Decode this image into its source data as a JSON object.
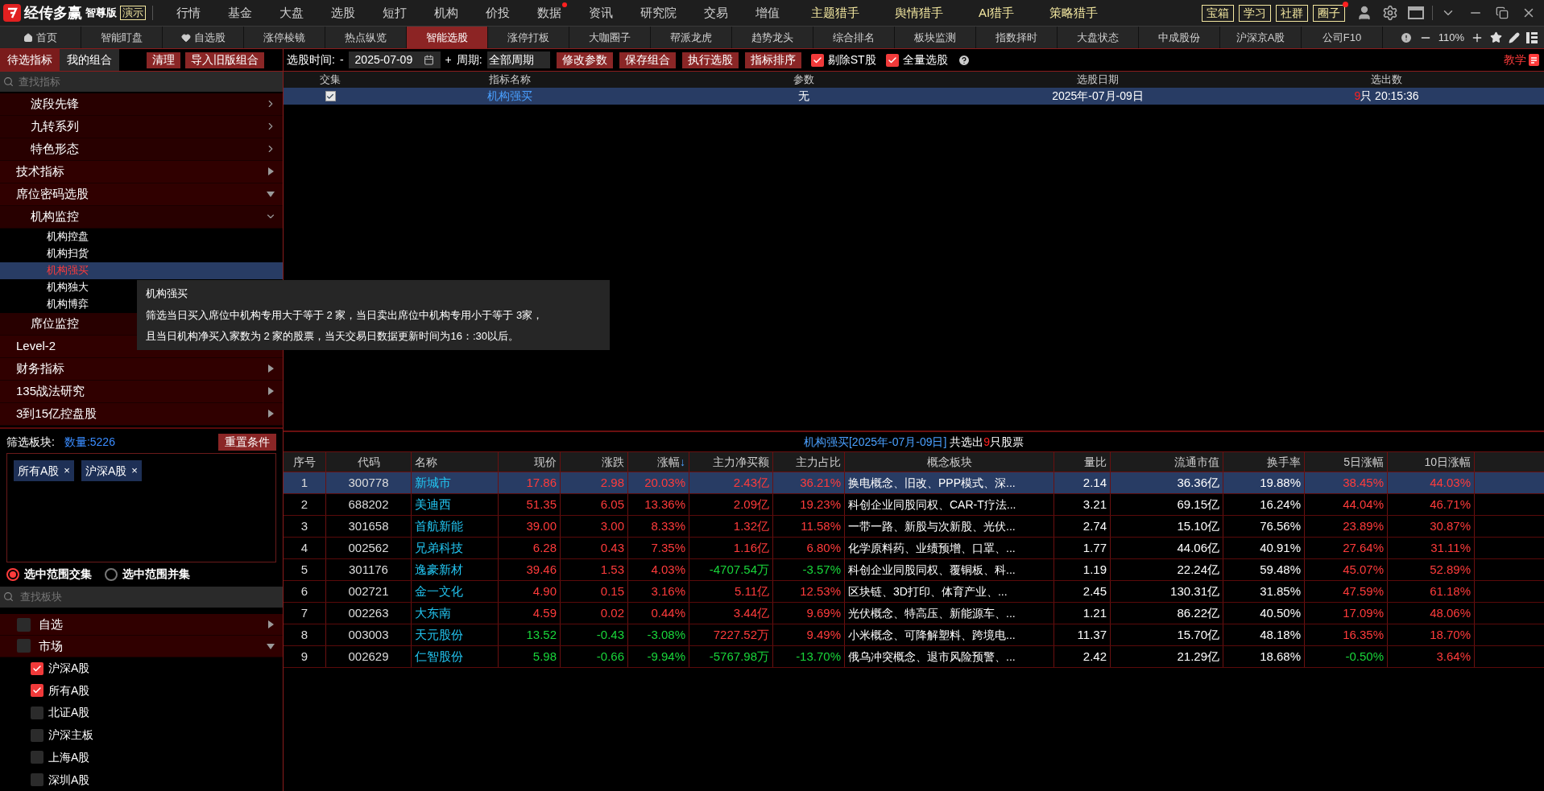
{
  "app": {
    "name": "经传多赢",
    "edition": "智尊版",
    "mode": "演示"
  },
  "menu": [
    {
      "label": "行情",
      "kind": "plain",
      "badge": false
    },
    {
      "label": "基金",
      "kind": "plain",
      "badge": false
    },
    {
      "label": "大盘",
      "kind": "plain",
      "badge": false
    },
    {
      "label": "选股",
      "kind": "plain",
      "badge": false
    },
    {
      "label": "短打",
      "kind": "plain",
      "badge": false
    },
    {
      "label": "机构",
      "kind": "plain",
      "badge": false
    },
    {
      "label": "价投",
      "kind": "plain",
      "badge": false
    },
    {
      "label": "数据",
      "kind": "plain",
      "badge": true
    },
    {
      "label": "资讯",
      "kind": "plain",
      "badge": false
    },
    {
      "label": "研究院",
      "kind": "plain",
      "badge": false
    },
    {
      "label": "交易",
      "kind": "plain",
      "badge": false
    },
    {
      "label": "增值",
      "kind": "plain",
      "badge": false
    },
    {
      "label": "主题猎手",
      "kind": "hunter",
      "badge": false
    },
    {
      "label": "舆情猎手",
      "kind": "hunter",
      "badge": false
    },
    {
      "label": "AI猎手",
      "kind": "hunter",
      "badge": false
    },
    {
      "label": "策略猎手",
      "kind": "hunter",
      "badge": false
    }
  ],
  "menu_boxes": [
    {
      "label": "宝箱",
      "badge": false
    },
    {
      "label": "学习",
      "badge": false
    },
    {
      "label": "社群",
      "badge": false
    },
    {
      "label": "圈子",
      "badge": true
    }
  ],
  "tabs": [
    {
      "label": "首页",
      "kind": "home",
      "selected": false
    },
    {
      "label": "智能盯盘",
      "kind": "plain",
      "selected": false
    },
    {
      "label": "自选股",
      "kind": "favorites",
      "selected": false
    },
    {
      "label": "涨停棱镜",
      "kind": "plain",
      "selected": false
    },
    {
      "label": "热点纵览",
      "kind": "plain",
      "selected": false
    },
    {
      "label": "智能选股",
      "kind": "plain",
      "selected": true
    },
    {
      "label": "涨停打板",
      "kind": "plain",
      "selected": false
    },
    {
      "label": "大咖圈子",
      "kind": "plain",
      "selected": false
    },
    {
      "label": "帮派龙虎",
      "kind": "plain",
      "selected": false
    },
    {
      "label": "趋势龙头",
      "kind": "plain",
      "selected": false
    },
    {
      "label": "综合排名",
      "kind": "plain",
      "selected": false
    },
    {
      "label": "板块监测",
      "kind": "plain",
      "selected": false
    },
    {
      "label": "指数择时",
      "kind": "plain",
      "selected": false
    },
    {
      "label": "大盘状态",
      "kind": "plain",
      "selected": false
    },
    {
      "label": "中成股份",
      "kind": "plain",
      "selected": false
    },
    {
      "label": "沪深京A股",
      "kind": "plain",
      "selected": false
    },
    {
      "label": "公司F10",
      "kind": "plain",
      "selected": false
    }
  ],
  "zoom": "110%",
  "panel_tabs": [
    {
      "label": "待选指标",
      "selected": true
    },
    {
      "label": "我的组合",
      "selected": false
    }
  ],
  "toolbar": {
    "clear": "清理",
    "import": "导入旧版组合",
    "date_label": "选股时间:",
    "date_dash": "-",
    "date": "2025-07-09",
    "plus": "+",
    "period_label": "周期:",
    "period": "全部周期",
    "buttons": [
      "修改参数",
      "保存组合",
      "执行选股",
      "指标排序"
    ],
    "checks": [
      {
        "label": "剔除ST股",
        "checked": true
      },
      {
        "label": "全量选股",
        "checked": true
      }
    ],
    "teach": "教学"
  },
  "indicator_search": {
    "placeholder": "查找指标"
  },
  "indicator_tree": {
    "continued": [
      {
        "label": "波段先锋",
        "expanded": false
      },
      {
        "label": "九转系列",
        "expanded": false
      },
      {
        "label": "特色形态",
        "expanded": false
      }
    ],
    "items": [
      {
        "label": "技术指标",
        "expanded": false
      },
      {
        "label": "席位密码选股",
        "expanded": true,
        "children": [
          {
            "label": "机构监控",
            "expanded": true,
            "children": [
              {
                "label": "机构控盘",
                "selected": false
              },
              {
                "label": "机构扫货",
                "selected": false
              },
              {
                "label": "机构强买",
                "selected": true
              },
              {
                "label": "机构独大",
                "selected": false
              },
              {
                "label": "机构博弈",
                "selected": false
              }
            ]
          },
          {
            "label": "席位监控"
          }
        ]
      },
      {
        "label": "Level-2"
      },
      {
        "label": "财务指标",
        "expanded": false
      },
      {
        "label": "135战法研究",
        "expanded": false
      },
      {
        "label": "3到15亿控盘股",
        "expanded": false
      }
    ]
  },
  "tooltip": {
    "title": "机构强买",
    "lines": [
      "筛选当日买入席位中机构专用大于等于 2 家，当日卖出席位中机构专用小于等于 3家，",
      "且当日机构净买入家数为 2 家的股票，当天交易日数据更新时间为16：:30以后。"
    ]
  },
  "board_filter": {
    "label": "筛选板块:",
    "count": "数量:5226",
    "reset": "重置条件",
    "tags": [
      {
        "label": "所有A股",
        "remove": "×"
      },
      {
        "label": "沪深A股",
        "remove": "×"
      }
    ],
    "modes": [
      {
        "label": "选中范围交集",
        "selected": true
      },
      {
        "label": "选中范围并集",
        "selected": false
      }
    ],
    "search": {
      "placeholder": "查找板块"
    },
    "tree": [
      {
        "label": "自选",
        "checked": false,
        "expanded": false
      },
      {
        "label": "市场",
        "checked": false,
        "expanded": true,
        "children": [
          {
            "label": "沪深A股",
            "checked": true
          },
          {
            "label": "所有A股",
            "checked": true
          },
          {
            "label": "北证A股",
            "checked": false
          },
          {
            "label": "沪深主板",
            "checked": false
          },
          {
            "label": "上海A股",
            "checked": false
          },
          {
            "label": "深圳A股",
            "checked": false
          }
        ]
      }
    ]
  },
  "indicator_table": {
    "columns": [
      "交集",
      "指标名称",
      "参数",
      "选股日期",
      "选出数"
    ],
    "rows": [
      {
        "checked": true,
        "name": "机构强买",
        "params": "无",
        "date": "2025年-07月-09日",
        "count": "9",
        "count_suffix": "只 20:15:36",
        "selected": true
      }
    ]
  },
  "result": {
    "title": "机构强买[2025年-07月-09日]",
    "prefix": "共选出",
    "count": "9",
    "suffix": "只股票",
    "columns": [
      {
        "label": "序号"
      },
      {
        "label": "代码"
      },
      {
        "label": "名称"
      },
      {
        "label": "现价"
      },
      {
        "label": "涨跌"
      },
      {
        "label": "涨幅",
        "sort_mark": "↓"
      },
      {
        "label": "主力净买额"
      },
      {
        "label": "主力占比"
      },
      {
        "label": "概念板块"
      },
      {
        "label": "量比"
      },
      {
        "label": "流通市值"
      },
      {
        "label": "换手率"
      },
      {
        "label": "5日涨幅"
      },
      {
        "label": "10日涨幅"
      }
    ],
    "rows": [
      {
        "selected": true,
        "price_up": true,
        "flow_up": true,
        "d5_up": true,
        "d10_up": true,
        "cells": [
          "1",
          "300778",
          "新城市",
          "17.86",
          "2.98",
          "20.03%",
          "2.43亿",
          "36.21%",
          "换电概念、旧改、PPP模式、深...",
          "2.14",
          "36.36亿",
          "19.88%",
          "38.45%",
          "44.03%"
        ]
      },
      {
        "selected": false,
        "price_up": true,
        "flow_up": true,
        "d5_up": true,
        "d10_up": true,
        "cells": [
          "2",
          "688202",
          "美迪西",
          "51.35",
          "6.05",
          "13.36%",
          "2.09亿",
          "19.23%",
          "科创企业同股同权、CAR-T疗法...",
          "3.21",
          "69.15亿",
          "16.24%",
          "44.04%",
          "46.71%"
        ]
      },
      {
        "selected": false,
        "price_up": true,
        "flow_up": true,
        "d5_up": true,
        "d10_up": true,
        "cells": [
          "3",
          "301658",
          "首航新能",
          "39.00",
          "3.00",
          "8.33%",
          "1.32亿",
          "11.58%",
          "一带一路、新股与次新股、光伏...",
          "2.74",
          "15.10亿",
          "76.56%",
          "23.89%",
          "30.87%"
        ]
      },
      {
        "selected": false,
        "price_up": true,
        "flow_up": true,
        "d5_up": true,
        "d10_up": true,
        "cells": [
          "4",
          "002562",
          "兄弟科技",
          "6.28",
          "0.43",
          "7.35%",
          "1.16亿",
          "6.80%",
          "化学原料药、业绩预增、口罩、...",
          "1.77",
          "44.06亿",
          "40.91%",
          "27.64%",
          "31.11%"
        ]
      },
      {
        "selected": false,
        "price_up": true,
        "flow_up": false,
        "d5_up": true,
        "d10_up": true,
        "cells": [
          "5",
          "301176",
          "逸豪新材",
          "39.46",
          "1.53",
          "4.03%",
          "-4707.54万",
          "-3.57%",
          "科创企业同股同权、覆铜板、科...",
          "1.19",
          "22.24亿",
          "59.48%",
          "45.07%",
          "52.89%"
        ]
      },
      {
        "selected": false,
        "price_up": true,
        "flow_up": true,
        "d5_up": true,
        "d10_up": true,
        "cells": [
          "6",
          "002721",
          "金一文化",
          "4.90",
          "0.15",
          "3.16%",
          "5.11亿",
          "12.53%",
          "区块链、3D打印、体育产业、...",
          "2.45",
          "130.31亿",
          "31.85%",
          "47.59%",
          "61.18%"
        ]
      },
      {
        "selected": false,
        "price_up": true,
        "flow_up": true,
        "d5_up": true,
        "d10_up": true,
        "cells": [
          "7",
          "002263",
          "大东南",
          "4.59",
          "0.02",
          "0.44%",
          "3.44亿",
          "9.69%",
          "光伏概念、特高压、新能源车、...",
          "1.21",
          "86.22亿",
          "40.50%",
          "17.09%",
          "48.06%"
        ]
      },
      {
        "selected": false,
        "price_up": false,
        "flow_up": true,
        "d5_up": true,
        "d10_up": true,
        "cells": [
          "8",
          "003003",
          "天元股份",
          "13.52",
          "-0.43",
          "-3.08%",
          "7227.52万",
          "9.49%",
          "小米概念、可降解塑料、跨境电...",
          "11.37",
          "15.70亿",
          "48.18%",
          "16.35%",
          "18.70%"
        ]
      },
      {
        "selected": false,
        "price_up": false,
        "flow_up": false,
        "d5_up": false,
        "d10_up": true,
        "cells": [
          "9",
          "002629",
          "仁智股份",
          "5.98",
          "-0.66",
          "-9.94%",
          "-5767.98万",
          "-13.70%",
          "俄乌冲突概念、退市风险预警、...",
          "2.42",
          "21.29亿",
          "18.68%",
          "-0.50%",
          "3.64%"
        ]
      }
    ]
  }
}
